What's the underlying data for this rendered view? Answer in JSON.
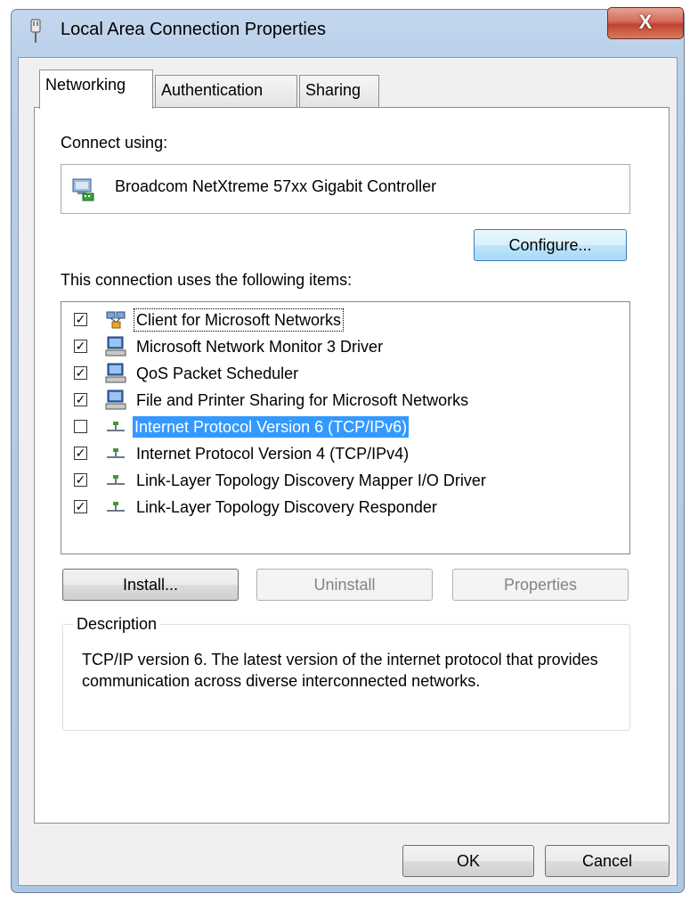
{
  "window": {
    "title": "Local Area Connection Properties",
    "close_label": "X"
  },
  "tabs": [
    {
      "label": "Networking",
      "active": true
    },
    {
      "label": "Authentication",
      "active": false
    },
    {
      "label": "Sharing",
      "active": false
    }
  ],
  "networking": {
    "connect_using_label": "Connect using:",
    "adapter_name": "Broadcom NetXtreme 57xx Gigabit Controller",
    "configure_label": "Configure...",
    "items_label": "This connection uses the following items:",
    "items": [
      {
        "label": "Client for Microsoft Networks",
        "checked": true,
        "icon": "network-client-icon"
      },
      {
        "label": "Microsoft Network Monitor 3 Driver",
        "checked": true,
        "icon": "computer-icon"
      },
      {
        "label": "QoS Packet Scheduler",
        "checked": true,
        "icon": "computer-icon"
      },
      {
        "label": "File and Printer Sharing for Microsoft Networks",
        "checked": true,
        "icon": "computer-icon"
      },
      {
        "label": "Internet Protocol Version 6 (TCP/IPv6)",
        "checked": false,
        "icon": "protocol-icon",
        "selected": true
      },
      {
        "label": "Internet Protocol Version 4 (TCP/IPv4)",
        "checked": true,
        "icon": "protocol-icon"
      },
      {
        "label": "Link-Layer Topology Discovery Mapper I/O Driver",
        "checked": true,
        "icon": "protocol-icon"
      },
      {
        "label": "Link-Layer Topology Discovery Responder",
        "checked": true,
        "icon": "protocol-icon"
      }
    ],
    "install_label": "Install...",
    "uninstall_label": "Uninstall",
    "properties_label": "Properties",
    "description_legend": "Description",
    "description_text": "TCP/IP version 6. The latest version of the internet protocol that provides communication across diverse interconnected networks."
  },
  "footer": {
    "ok_label": "OK",
    "cancel_label": "Cancel"
  },
  "colors": {
    "selection": "#3399ff",
    "close_button": "#c04230",
    "frame": "#b9cfe9"
  }
}
